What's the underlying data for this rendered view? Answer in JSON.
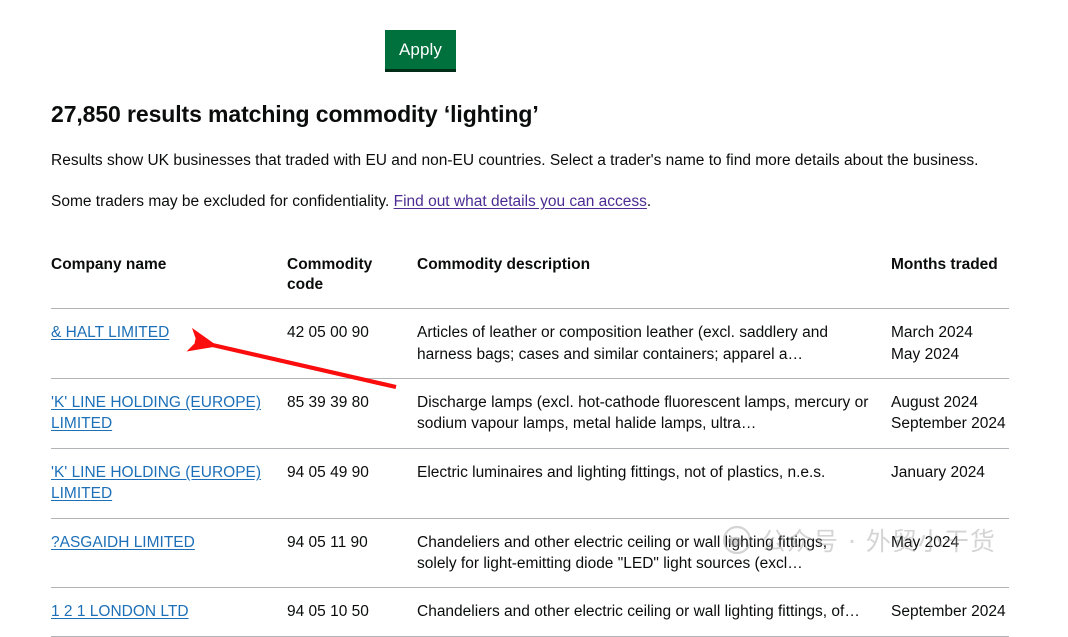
{
  "toolbar": {
    "apply_label": "Apply",
    "apply_bg": "#00703c"
  },
  "heading": {
    "title": "27,850 results matching commodity ‘lighting’",
    "result_count": "27,850",
    "commodity_term": "lighting"
  },
  "intro": {
    "paragraph_1": "Results show UK businesses that traded with EU and non-EU countries. Select a trader's name to find more details about the business.",
    "paragraph_2_prefix": "Some traders may be excluded for confidentiality. ",
    "paragraph_2_link": "Find out what details you can access",
    "paragraph_2_suffix": ".",
    "link_color": "#4c2c92"
  },
  "table": {
    "headers": {
      "company": "Company name",
      "code": "Commodity code",
      "description": "Commodity description",
      "months": "Months traded"
    },
    "link_color": "#1d70b8",
    "rows": [
      {
        "company": "& HALT LIMITED",
        "code": "42 05 00 90",
        "description": "Articles of leather or composition leather (excl. saddlery and harness bags; cases and similar containers; apparel a…",
        "month_1": "March 2024",
        "month_2": "May 2024"
      },
      {
        "company": "'K' LINE HOLDING (EUROPE) LIMITED",
        "code": "85 39 39 80",
        "description": "Discharge lamps (excl. hot-cathode fluorescent lamps, mercury or sodium vapour lamps, metal halide lamps, ultra…",
        "month_1": "August 2024",
        "month_2": "September 2024"
      },
      {
        "company": "'K' LINE HOLDING (EUROPE) LIMITED",
        "code": "94 05 49 90",
        "description": "Electric luminaires and lighting fittings, not of plastics, n.e.s.",
        "month_1": "January 2024",
        "month_2": ""
      },
      {
        "company": "?ASGAIDH LIMITED",
        "code": "94 05 11 90",
        "description": "Chandeliers and other electric ceiling or wall lighting fittings, solely for light-emitting diode \"LED\" light sources (excl…",
        "month_1": "May 2024",
        "month_2": ""
      },
      {
        "company": "1 2 1 LONDON LTD",
        "code": "94 05 10 50",
        "description": "Chandeliers and other electric ceiling or wall lighting fittings, of…",
        "month_1": "September 2024",
        "month_2": ""
      }
    ]
  },
  "annotation": {
    "arrow_color": "#fc0d0d"
  },
  "watermark": {
    "text": "公众号 · 外贸小干货",
    "color": "#9a9a9a"
  }
}
